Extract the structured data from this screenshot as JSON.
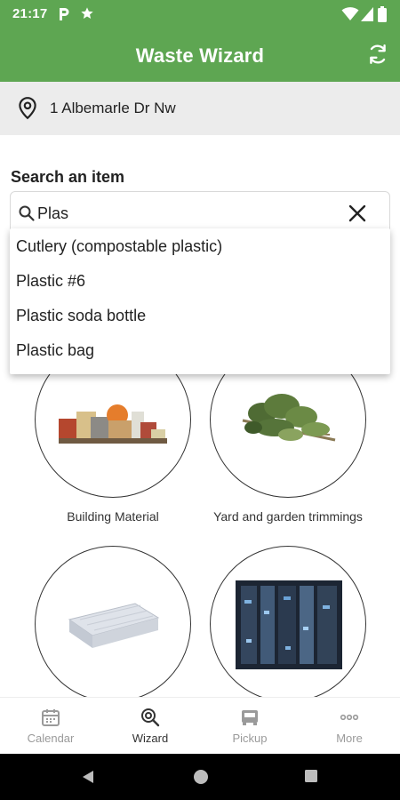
{
  "status": {
    "time": "21:17"
  },
  "app": {
    "title": "Waste Wizard",
    "accent": "#5ea652"
  },
  "address": {
    "text": "1 Albemarle Dr Nw"
  },
  "search": {
    "label": "Search an item",
    "value": "Plas",
    "suggestions": [
      "Cutlery (compostable plastic)",
      "Plastic #6",
      "Plastic soda bottle",
      "Plastic bag"
    ]
  },
  "categories": [
    {
      "label": "Building Material",
      "icon": "building-material-image"
    },
    {
      "label": "Yard and garden trimmings",
      "icon": "yard-trimmings-image"
    },
    {
      "label": "",
      "icon": "mattress-image"
    },
    {
      "label": "",
      "icon": "electronics-image"
    }
  ],
  "nav": {
    "items": [
      {
        "label": "Calendar",
        "icon": "calendar-icon",
        "active": false
      },
      {
        "label": "Wizard",
        "icon": "wizard-search-icon",
        "active": true
      },
      {
        "label": "Pickup",
        "icon": "pickup-truck-icon",
        "active": false
      },
      {
        "label": "More",
        "icon": "more-dots-icon",
        "active": false
      }
    ]
  }
}
